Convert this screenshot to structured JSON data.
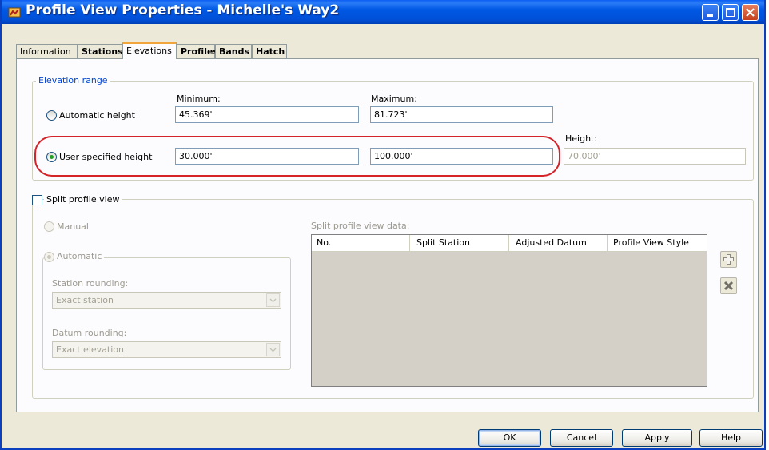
{
  "window": {
    "title": "Profile View Properties - Michelle's Way2"
  },
  "tabs": [
    {
      "label": "Information",
      "active": false
    },
    {
      "label": "Stations",
      "active": false
    },
    {
      "label": "Elevations",
      "active": true
    },
    {
      "label": "Profiles",
      "active": false
    },
    {
      "label": "Bands",
      "active": false
    },
    {
      "label": "Hatch",
      "active": false
    }
  ],
  "elevation_range": {
    "label": "Elevation range",
    "minimum_label": "Minimum:",
    "maximum_label": "Maximum:",
    "height_label": "Height:",
    "automatic": {
      "label": "Automatic height",
      "selected": false,
      "minimum": "45.369'",
      "maximum": "81.723'"
    },
    "user_specified": {
      "label": "User specified height",
      "selected": true,
      "minimum": "30.000'",
      "maximum": "100.000'",
      "height": "70.000'"
    },
    "highlight_color": "#d5232a"
  },
  "split_profile": {
    "checkbox_label": "Split profile view",
    "checked": false,
    "manual_label": "Manual",
    "automatic_label": "Automatic",
    "station_rounding_label": "Station rounding:",
    "station_rounding_value": "Exact station",
    "datum_rounding_label": "Datum rounding:",
    "datum_rounding_value": "Exact elevation",
    "data_label": "Split profile view data:",
    "columns": [
      "No.",
      "Split Station",
      "Adjusted Datum",
      "Profile View Style"
    ],
    "rows": [],
    "add_icon": "add-plus-icon",
    "delete_icon": "delete-x-icon"
  },
  "buttons": {
    "ok": "OK",
    "cancel": "Cancel",
    "apply": "Apply",
    "help": "Help"
  }
}
